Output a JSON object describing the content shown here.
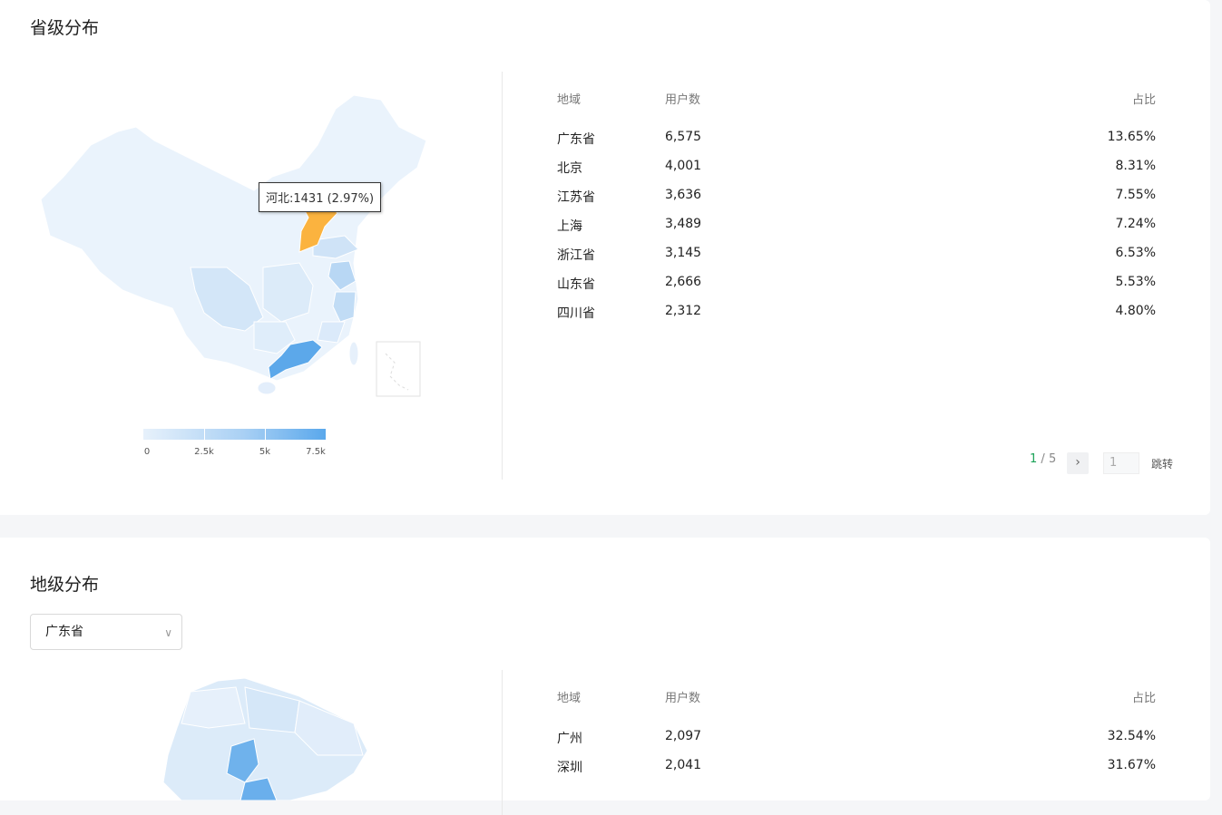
{
  "province_section": {
    "title": "省级分布",
    "tooltip": "河北:1431 (2.97%)",
    "legend": {
      "ticks": [
        "0",
        "2.5k",
        "5k",
        "7.5k"
      ],
      "max": 7500
    },
    "table": {
      "headers": {
        "region": "地域",
        "users": "用户数",
        "ratio": "占比"
      },
      "rows": [
        {
          "region": "广东省",
          "users": "6,575",
          "ratio": "13.65%"
        },
        {
          "region": "北京",
          "users": "4,001",
          "ratio": "8.31%"
        },
        {
          "region": "江苏省",
          "users": "3,636",
          "ratio": "7.55%"
        },
        {
          "region": "上海",
          "users": "3,489",
          "ratio": "7.24%"
        },
        {
          "region": "浙江省",
          "users": "3,145",
          "ratio": "6.53%"
        },
        {
          "region": "山东省",
          "users": "2,666",
          "ratio": "5.53%"
        },
        {
          "region": "四川省",
          "users": "2,312",
          "ratio": "4.80%"
        }
      ]
    },
    "pager": {
      "current": "1",
      "separator": "/",
      "total": "5",
      "next": "›",
      "input_placeholder": "1",
      "jump": "跳转"
    }
  },
  "city_section": {
    "title": "地级分布",
    "select_value": "广东省",
    "table": {
      "headers": {
        "region": "地域",
        "users": "用户数",
        "ratio": "占比"
      },
      "rows": [
        {
          "region": "广州",
          "users": "2,097",
          "ratio": "32.54%"
        },
        {
          "region": "深圳",
          "users": "2,041",
          "ratio": "31.67%"
        }
      ]
    }
  },
  "colors": {
    "highlight": "#fbb33f",
    "accent": "#1ba358",
    "map_light": "#e8f2fc",
    "map_dark": "#5aa8ec"
  }
}
